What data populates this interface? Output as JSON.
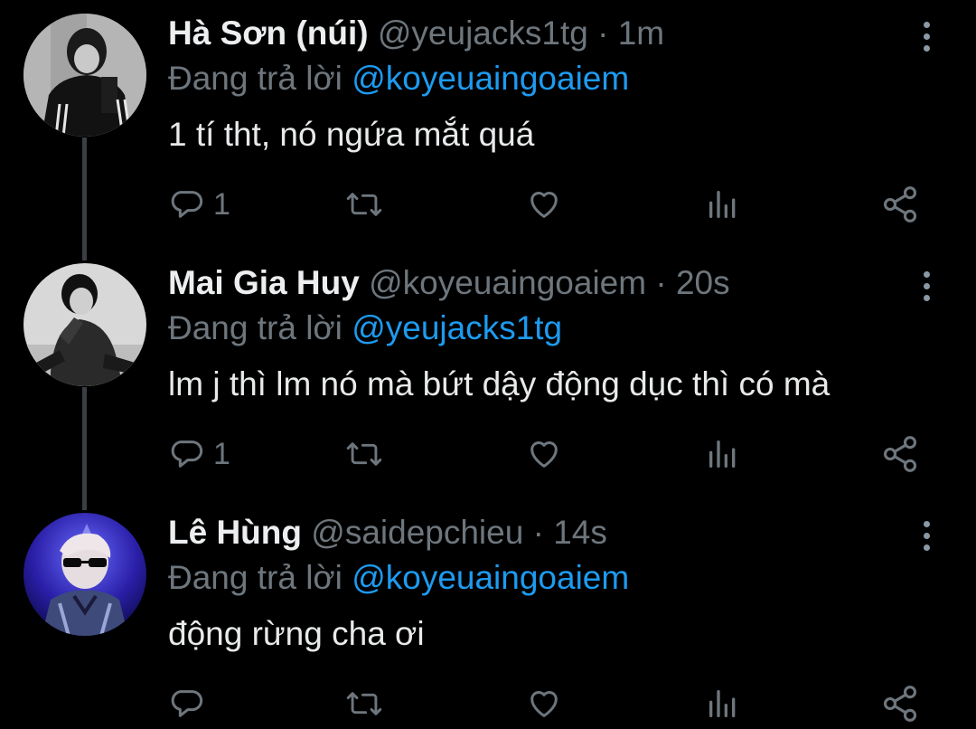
{
  "thread": {
    "tweets": [
      {
        "display_name": "Hà Sơn (núi)",
        "handle": "@yeujacks1tg",
        "separator": "·",
        "time": "1m",
        "reply_prefix": "Đang trả lời",
        "reply_to": "@koyeuaingoaiem",
        "text": "1 tí tht, nó ngứa mắt quá",
        "reply_count": "1",
        "avatar_icon": "avatar-photo"
      },
      {
        "display_name": "Mai Gia Huy",
        "handle": "@koyeuaingoaiem",
        "separator": "·",
        "time": "20s",
        "reply_prefix": "Đang trả lời",
        "reply_to": "@yeujacks1tg",
        "text": "lm j thì lm nó mà bứt dậy động dục thì có mà",
        "reply_count": "1",
        "avatar_icon": "avatar-photo"
      },
      {
        "display_name": "Lê Hùng",
        "handle": "@saidepchieu",
        "separator": "·",
        "time": "14s",
        "reply_prefix": "Đang trả lời",
        "reply_to": "@koyeuaingoaiem",
        "text": "động rừng cha ơi",
        "reply_count": "",
        "avatar_icon": "avatar-photo"
      }
    ]
  },
  "icons": {
    "reply": "reply-icon",
    "retweet": "retweet-icon",
    "like": "heart-icon",
    "analytics": "analytics-icon",
    "share": "share-icon",
    "more": "more-vertical-icon"
  },
  "colors": {
    "background": "#000000",
    "mention": "#1d9bf0",
    "muted": "#6e767d",
    "text": "#e7e9ea"
  }
}
